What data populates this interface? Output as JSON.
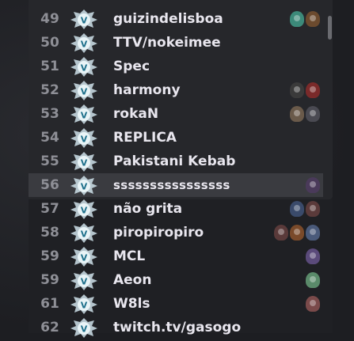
{
  "rows": [
    {
      "rank": "49",
      "name": "guizindelisboa",
      "heroes": [
        "#6b4a2e",
        "#3c8a7a"
      ]
    },
    {
      "rank": "50",
      "name": "TTV/nokeimee",
      "heroes": []
    },
    {
      "rank": "51",
      "name": "Spec",
      "heroes": []
    },
    {
      "rank": "52",
      "name": "harmony",
      "heroes": [
        "#7a2a2a",
        "#3a3a3a"
      ]
    },
    {
      "rank": "53",
      "name": "rokaN",
      "heroes": [
        "#4a4a52",
        "#6a5a4a"
      ]
    },
    {
      "rank": "54",
      "name": "REPLICA",
      "heroes": []
    },
    {
      "rank": "55",
      "name": "Pakistani Kebab",
      "heroes": []
    },
    {
      "rank": "56",
      "name": "ssssssssssssssss",
      "heroes": [
        "#4a3a5a"
      ]
    },
    {
      "rank": "57",
      "name": "não grita",
      "heroes": [
        "#5a3a3a",
        "#3a4a6a"
      ]
    },
    {
      "rank": "58",
      "name": "piropiropiro",
      "heroes": [
        "#4a5a7a",
        "#7a4a2a",
        "#5a3a3a"
      ]
    },
    {
      "rank": "59",
      "name": "MCL",
      "heroes": [
        "#5a4a7a"
      ]
    },
    {
      "rank": "59",
      "name": "Aeon",
      "heroes": [
        "#5a8a6a"
      ]
    },
    {
      "rank": "61",
      "name": "W8ls",
      "heroes": [
        "#7a4a4a"
      ]
    },
    {
      "rank": "62",
      "name": "twitch.tv/gasogo",
      "heroes": []
    }
  ],
  "highlight_rank": "56",
  "colors": {
    "badge": "#cfe2ea",
    "badge_letter": "#1d6f8a",
    "highlight": "#3a3b40"
  },
  "icons": {
    "badge": "divine-rank-badge-icon",
    "hero": "hero-portrait-icon"
  }
}
